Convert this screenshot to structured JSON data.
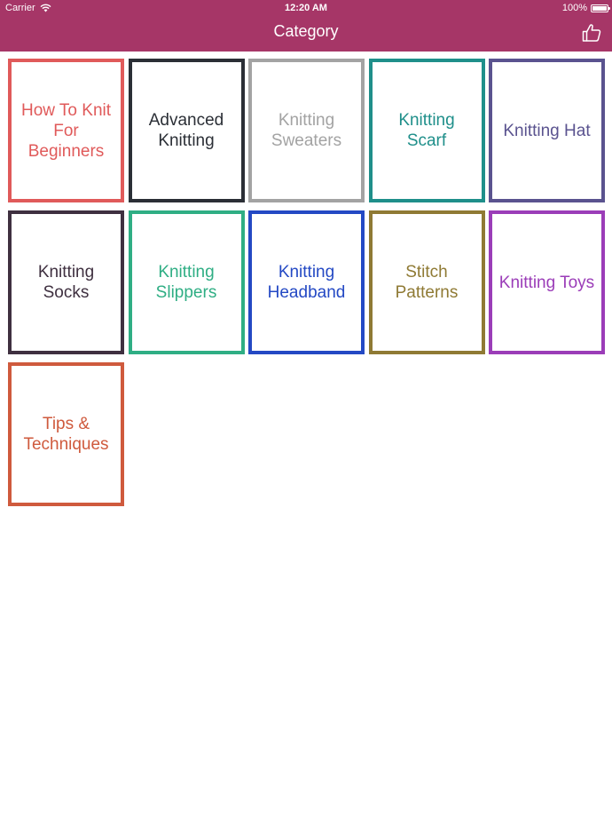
{
  "status_bar": {
    "carrier": "Carrier",
    "time": "12:20 AM",
    "battery": "100%"
  },
  "nav": {
    "title": "Category",
    "like_icon": "thumbs-up-icon"
  },
  "categories": [
    {
      "label": "How To Knit For Beginners",
      "color": "#e05a5a"
    },
    {
      "label": "Advanced Knitting",
      "color": "#2b2f36"
    },
    {
      "label": "Knitting Sweaters",
      "color": "#a3a3a3"
    },
    {
      "label": "Knitting Scarf",
      "color": "#1f8f8a"
    },
    {
      "label": "Knitting Hat",
      "color": "#5a538f"
    },
    {
      "label": "Knitting Socks",
      "color": "#3f3040"
    },
    {
      "label": "Knitting Slippers",
      "color": "#2fae84"
    },
    {
      "label": "Knitting Headband",
      "color": "#2449c4"
    },
    {
      "label": "Stitch Patterns",
      "color": "#8f7a34"
    },
    {
      "label": "Knitting Toys",
      "color": "#9b3db8"
    },
    {
      "label": "Tips & Techniques",
      "color": "#cf5a3d"
    }
  ]
}
